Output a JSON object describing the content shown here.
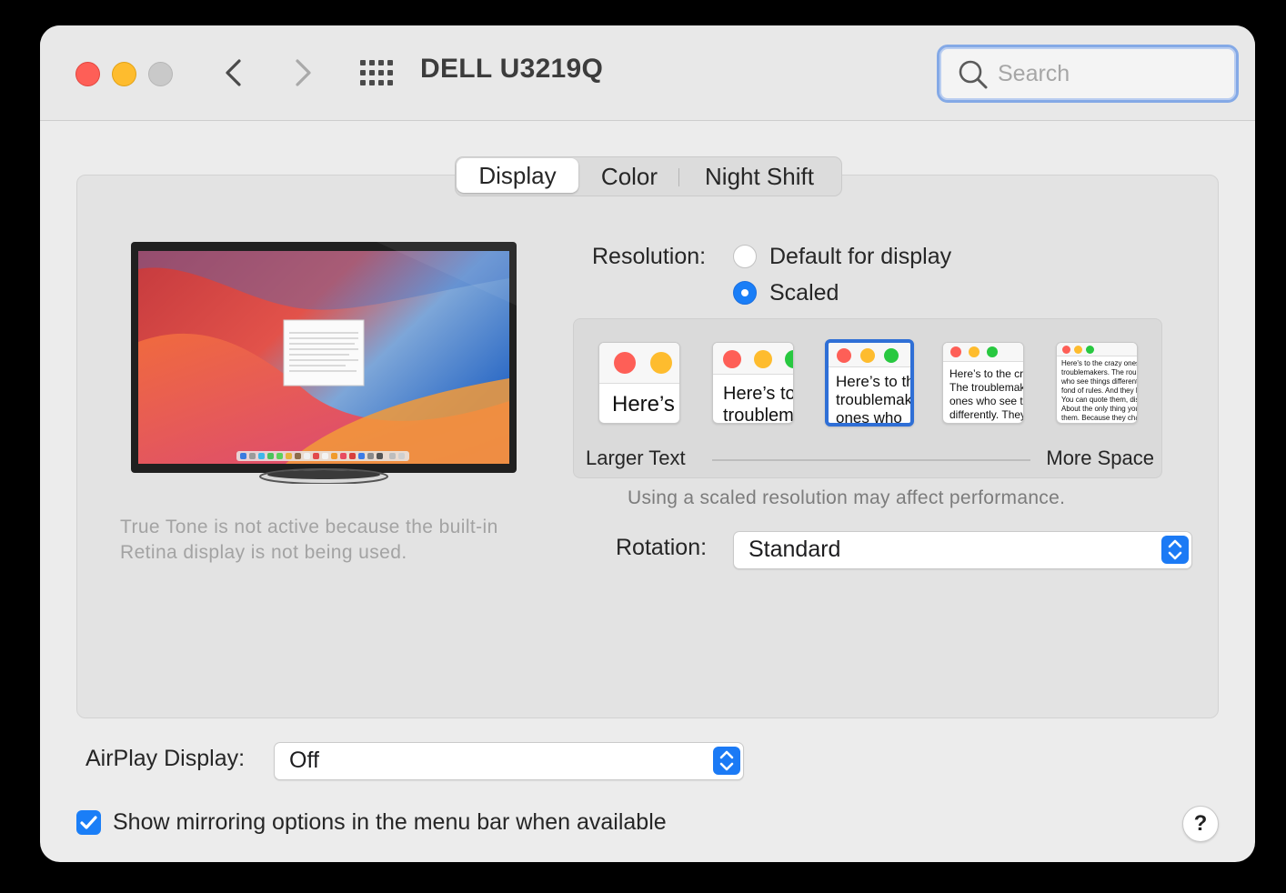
{
  "window": {
    "title": "DELL U3219Q"
  },
  "search": {
    "placeholder": "Search"
  },
  "tabs": [
    {
      "label": "Display",
      "selected": true
    },
    {
      "label": "Color",
      "selected": false
    },
    {
      "label": "Night Shift",
      "selected": false
    }
  ],
  "true_tone_note": "True Tone is not active because the built-in Retina display is not being used.",
  "resolution": {
    "label": "Resolution:",
    "options": [
      {
        "label": "Default for display",
        "selected": false
      },
      {
        "label": "Scaled",
        "selected": true
      }
    ],
    "scale_previews": [
      {
        "sample_text": "Here’s"
      },
      {
        "sample_text": "Here’s to the troublemakers"
      },
      {
        "sample_text": "Here’s to the troublemakers. The ones who"
      },
      {
        "sample_text": "Here’s to the crazy ones. The troublemakers. The ones who see things differently. They're not fond of rules. And they"
      },
      {
        "sample_text": "Here's to the crazy ones. The misfits. The troublemakers. The round pegs. The ones who see things differently. They're not fond of rules. And they have no respect. You can quote them, disagree with them. About the only thing you can't do is ignore them. Because they change things."
      }
    ],
    "selected_index": 2,
    "larger_text_label": "Larger Text",
    "more_space_label": "More Space",
    "performance_note": "Using a scaled resolution may affect performance."
  },
  "rotation": {
    "label": "Rotation:",
    "value": "Standard"
  },
  "airplay": {
    "label": "AirPlay Display:",
    "value": "Off"
  },
  "mirroring": {
    "label": "Show mirroring options in the menu bar when available",
    "checked": true
  },
  "help": {
    "label": "?"
  },
  "colors": {
    "accent": "#1a7ef7",
    "close": "#fe5f57",
    "minimize": "#febc2e",
    "zoom_disabled": "#c9c9c9",
    "thumb_green": "#28c840"
  }
}
